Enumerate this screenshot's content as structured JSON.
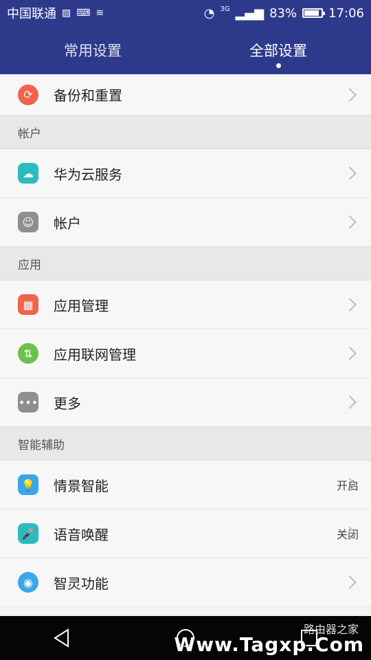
{
  "status_bar": {
    "carrier": "中国联通",
    "battery": "83%",
    "time": "17:06",
    "network": "3G",
    "icons": [
      "image-icon",
      "keyboard-icon",
      "wifi-small-icon",
      "wifi-icon",
      "signal-icon",
      "battery-icon"
    ]
  },
  "tabs": [
    {
      "label": "常用设置",
      "selected": false
    },
    {
      "label": "全部设置",
      "selected": true
    }
  ],
  "rows_top": {
    "backup_reset": {
      "label": "备份和重置",
      "icon": "backup-reset-icon",
      "color": "#f0634c"
    }
  },
  "sections": {
    "account": "帐户",
    "apps": "应用",
    "smart_assist": "智能辅助"
  },
  "account_items": [
    {
      "label": "华为云服务",
      "icon": "cloud-icon",
      "color": "#2bbcc0"
    },
    {
      "label": "帐户",
      "icon": "person-icon",
      "color": "#8e8e93"
    }
  ],
  "app_items": [
    {
      "label": "应用管理",
      "icon": "app-grid-icon",
      "color": "#f0634c"
    },
    {
      "label": "应用联网管理",
      "icon": "network-arrows-icon",
      "color": "#6dc04b"
    },
    {
      "label": "更多",
      "icon": "more-dots-icon",
      "color": "#8e8e93"
    }
  ],
  "smart_items": [
    {
      "label": "情景智能",
      "value": "开启",
      "icon": "lightbulb-icon",
      "color": "#3aa7e8"
    },
    {
      "label": "语音唤醒",
      "value": "关闭",
      "icon": "voice-icon",
      "color": "#2bbcc0"
    },
    {
      "label": "智灵功能",
      "icon": "smart-circle-icon",
      "color": "#3aa7e8"
    }
  ],
  "nav_bar": {
    "buttons": [
      "back-icon",
      "home-icon",
      "recents-icon"
    ]
  },
  "watermark": {
    "text": "Www.Tagxp.Com",
    "sub": "路由器之家"
  }
}
